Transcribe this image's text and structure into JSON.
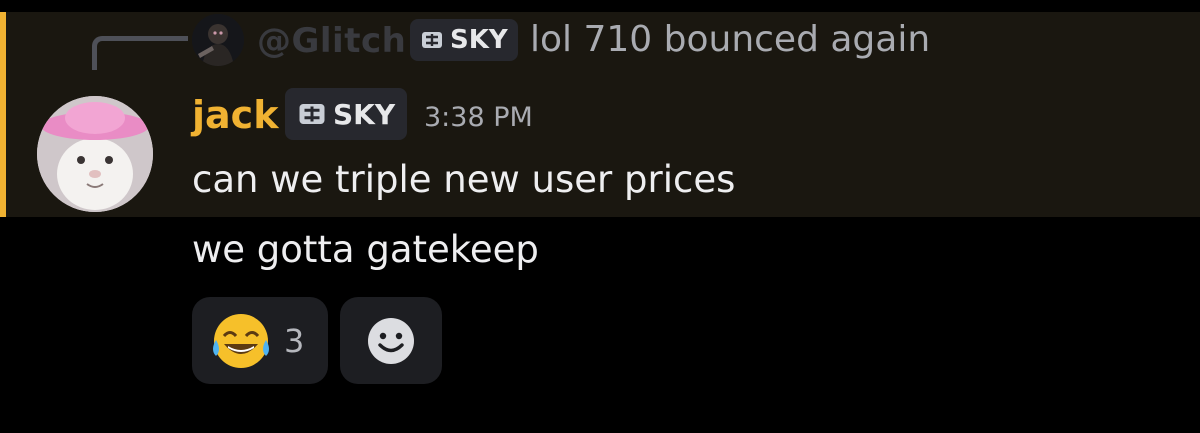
{
  "reply": {
    "username": "@Glitch",
    "tag_label": "SKY",
    "text": "lol 710 bounced again"
  },
  "message": {
    "author": "jack",
    "tag_label": "SKY",
    "timestamp": "3:38 PM",
    "lines": [
      "can we triple new user prices",
      "we gotta gatekeep"
    ]
  },
  "reactions": [
    {
      "emoji": "face-with-tears-of-joy",
      "count": "3"
    }
  ],
  "colors": {
    "author": "#f0b232",
    "highlight_bar": "#f0b232",
    "highlight_bg": "#1a1710",
    "tag_bg": "#27282e"
  }
}
